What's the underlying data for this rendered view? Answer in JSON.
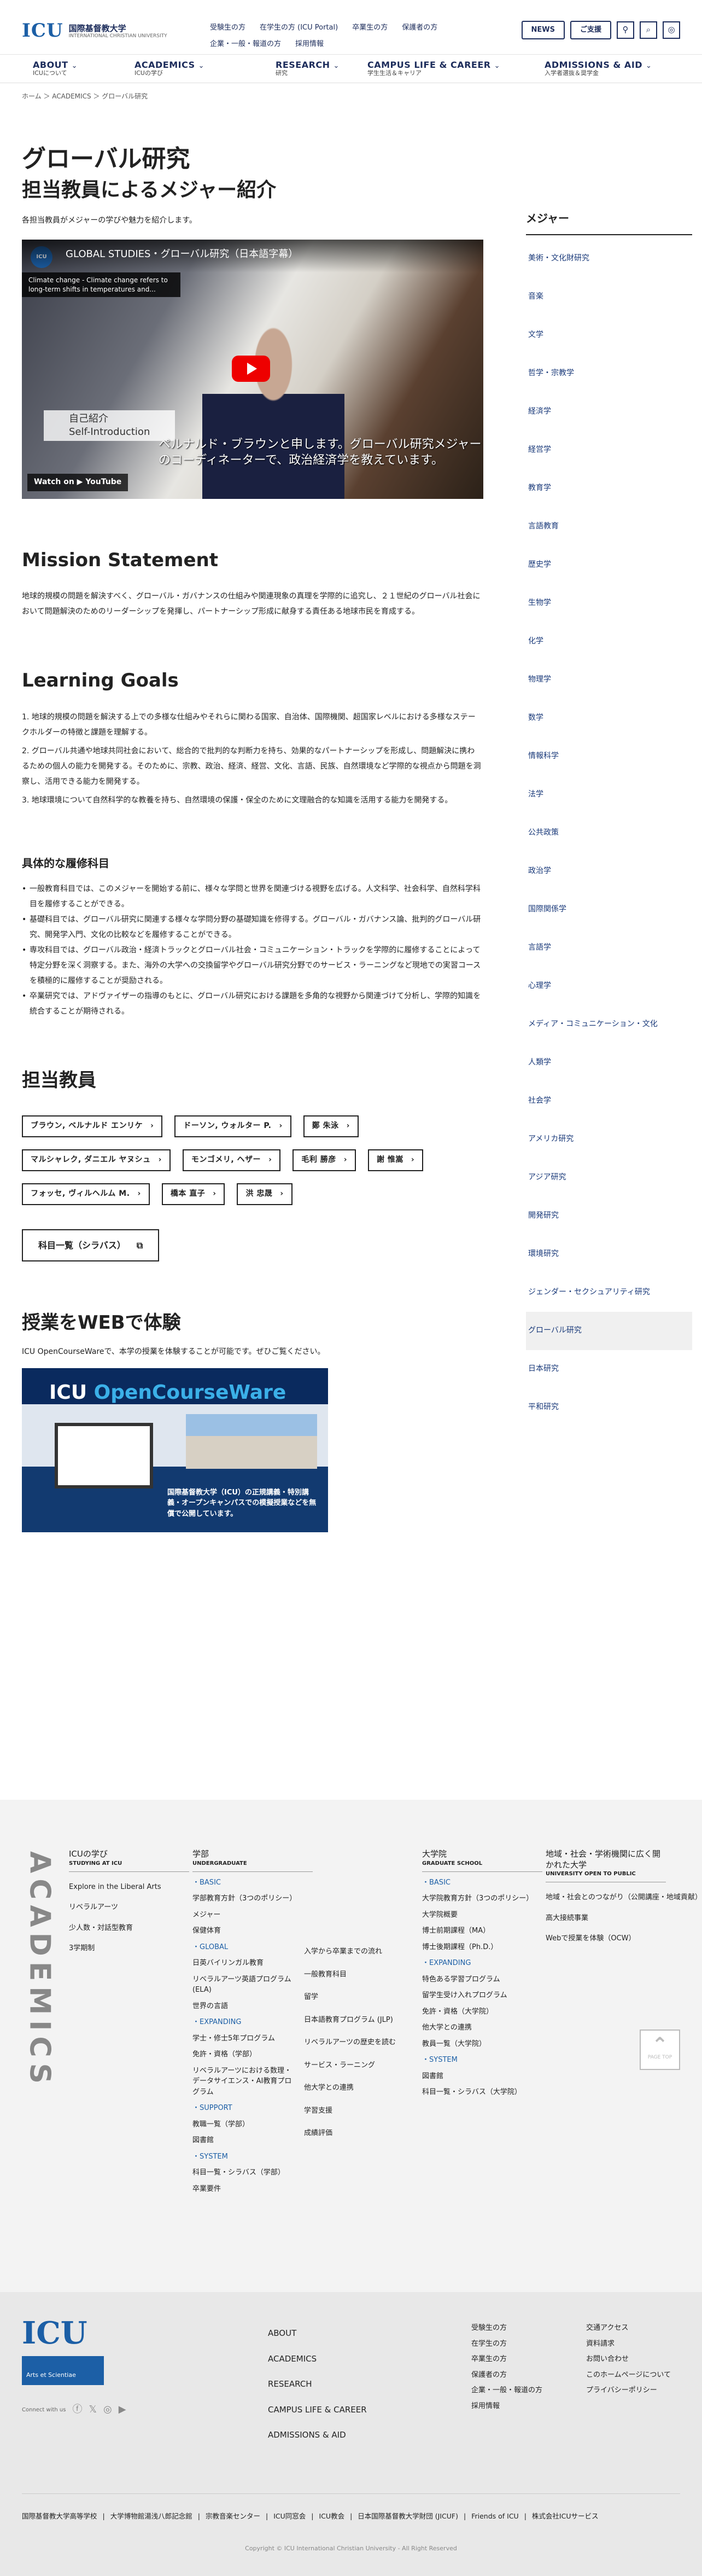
{
  "header": {
    "logo": "ICU",
    "school": "国際基督教大学",
    "school_en": "INTERNATIONAL CHRISTIAN UNIVERSITY",
    "util": [
      "受験生の方",
      "在学生の方 (ICU Portal)",
      "卒業生の方",
      "保護者の方",
      "企業・一般・報道の方",
      "採用情報"
    ],
    "news": "NEWS",
    "donate": "ご支援",
    "map_icon": "pin-icon",
    "search_icon": "search-icon",
    "lang_icon": "globe-icon"
  },
  "nav": [
    {
      "en": "ABOUT",
      "ja": "ICUについて"
    },
    {
      "en": "ACADEMICS",
      "ja": "ICUの学び"
    },
    {
      "en": "RESEARCH",
      "ja": "研究"
    },
    {
      "en": "CAMPUS LIFE & CAREER",
      "ja": "学生生活＆キャリア"
    },
    {
      "en": "ADMISSIONS & AID",
      "ja": "入学者選抜＆奨学金"
    }
  ],
  "breadcrumb": "ホーム ＞ ACADEMICS ＞ グローバル研究",
  "page": {
    "title": "グローバル研究",
    "subtitle": "担当教員によるメジャー紹介",
    "lead": "各担当教員がメジャーの学びや魅力を紹介します。"
  },
  "video": {
    "title": "GLOBAL STUDIES・グローバル研究（日本語字幕）",
    "caption": "Climate change - Climate change refers to long-term shifts in temperatures and...",
    "label1": "自己紹介",
    "label2": "Self-Introduction",
    "subtitle": "ペルナルド・ブラウンと申します。グローバル研究メジャーのコーディネーターで、政治経済学を教えています。",
    "watch": "Watch on ▶ YouTube"
  },
  "mission": {
    "title": "Mission Statement",
    "text": "地球的規模の問題を解決すべく、グローバル・ガバナンスの仕組みや関連現象の真理を学際的に追究し、２１世紀のグローバル社会において問題解決のためのリーダーシップを発揮し、パートナーシップ形成に献身する責任ある地球市民を育成する。"
  },
  "goals": {
    "title": "Learning Goals",
    "items": [
      "1. 地球的規模の問題を解決する上での多様な仕組みやそれらに関わる国家、自治体、国際機関、超国家レベルにおける多様なステークホルダーの特徴と課題を理解する。",
      "2. グローバル共通や地球共同社会において、総合的で批判的な判断力を持ち、効果的なパートナーシップを形成し、問題解決に携わるための個人の能力を開発する。そのために、宗教、政治、経済、経営、文化、言語、民族、自然環境など学際的な視点から問題を洞察し、活用できる能力を開発する。",
      "3. 地球環境について自然科学的な教養を持ち、自然環境の保護・保全のために文理融合的な知識を活用する能力を開発する。"
    ]
  },
  "courses": {
    "title": "具体的な履修科目",
    "items": [
      "一般教育科目では、このメジャーを開始する前に、様々な学問と世界を関連づける視野を広げる。人文科学、社会科学、自然科学科目を履修することができる。",
      "基礎科目では、グローバル研究に関連する様々な学問分野の基礎知識を修得する。グローバル・ガバナンス論、批判的グローバル研究、開発学入門、文化の比較などを履修することができる。",
      "専攻科目では、グローバル政治・経済トラックとグローバル社会・コミュニケーション・トラックを学際的に履修することによって特定分野を深く洞察する。また、海外の大学への交換留学やグローバル研究分野でのサービス・ラーニングなど現地での実習コースを積極的に履修することが奨励される。",
      "卒業研究では、アドヴァイザーの指導のもとに、グローバル研究における課題を多角的な視野から関連づけて分析し、学際的知識を統合することが期待される。"
    ]
  },
  "faculty": {
    "title": "担当教員",
    "members": [
      "ブラウン, ベルナルド エンリケ",
      "ドーソン, ウォルター P.",
      "鄭 朱泳",
      "マルシャレク, ダニエル ヤヌシュ",
      "モンゴメリ, ヘザー",
      "毛利 勝彦",
      "謝 惟嵩",
      "フォッセ, ヴィルヘルム M.",
      "橋本 直子",
      "洪 忠晟"
    ],
    "syllabus": "科目一覧（シラバス）"
  },
  "web": {
    "title": "授業をWEBで体験",
    "text": "ICU OpenCourseWareで、本学の授業を体験することが可能です。ぜひご覧ください。",
    "banner_a": "ICU ",
    "banner_b": "OpenCourseWare",
    "banner_text": "国際基督教大学（ICU）の正規講義・特別講義・オープンキャンパスでの模擬授業などを無償で公開しています。"
  },
  "side": {
    "title": "メジャー",
    "items": [
      "美術・文化財研究",
      "音楽",
      "文学",
      "哲学・宗教学",
      "経済学",
      "経営学",
      "教育学",
      "言語教育",
      "歴史学",
      "生物学",
      "化学",
      "物理学",
      "数学",
      "情報科学",
      "法学",
      "公共政策",
      "政治学",
      "国際関係学",
      "言語学",
      "心理学",
      "メディア・コミュニケーション・文化",
      "人類学",
      "社会学",
      "アメリカ研究",
      "アジア研究",
      "開発研究",
      "環境研究",
      "ジェンダー・セクシュアリティ研究",
      "グローバル研究",
      "日本研究",
      "平和研究"
    ],
    "active": "グローバル研究"
  },
  "footer": {
    "vertical": "ACADEMICS",
    "c1": {
      "t": "ICUの学び",
      "s": "STUDYING AT ICU",
      "items": [
        "Explore in the Liberal Arts",
        "リベラルアーツ",
        "少人数・対話型教育",
        "3学期制"
      ]
    },
    "c2": {
      "t": "学部",
      "s": "UNDERGRADUATE",
      "items": [
        [
          "・BASIC",
          "cat"
        ],
        [
          "学部教育方針（3つのポリシー）",
          ""
        ],
        [
          "メジャー",
          ""
        ],
        [
          "保健体育",
          ""
        ],
        [
          "・GLOBAL",
          "cat"
        ],
        [
          "日英バイリンガル教育",
          ""
        ],
        [
          "リベラルアーツ英語プログラム (ELA)",
          ""
        ],
        [
          "世界の言語",
          ""
        ],
        [
          "・EXPANDING",
          "cat"
        ],
        [
          "学士・修士5年プログラム",
          ""
        ],
        [
          "免許・資格（学部）",
          ""
        ],
        [
          "リベラルアーツにおける数理・データサイエンス・AI教育プログラム",
          ""
        ],
        [
          "・SUPPORT",
          "cat"
        ],
        [
          "教職一覧（学部）",
          ""
        ],
        [
          "図書館",
          ""
        ],
        [
          "・SYSTEM",
          "cat"
        ],
        [
          "科目一覧・シラバス（学部）",
          ""
        ],
        [
          "卒業要件",
          ""
        ]
      ]
    },
    "c2b": [
      "入学から卒業までの流れ",
      "一般教育科目",
      "留学",
      "日本語教育プログラム (JLP)",
      "リベラルアーツの歴史を読む",
      "サービス・ラーニング",
      "他大学との連携",
      "学習支援",
      "成績評価"
    ],
    "c3": {
      "t": "大学院",
      "s": "GRADUATE SCHOOL",
      "items": [
        [
          "・BASIC",
          "cat"
        ],
        [
          "大学院教育方針（3つのポリシー）",
          ""
        ],
        [
          "大学院概要",
          ""
        ],
        [
          "博士前期課程（MA）",
          ""
        ],
        [
          "博士後期課程（Ph.D.）",
          ""
        ],
        [
          "・EXPANDING",
          "cat"
        ],
        [
          "特色ある学習プログラム",
          ""
        ],
        [
          "留学生受け入れプログラム",
          ""
        ],
        [
          "免許・資格（大学院）",
          ""
        ],
        [
          "他大学との連携",
          ""
        ],
        [
          "教員一覧（大学院）",
          ""
        ],
        [
          "・SYSTEM",
          "cat"
        ],
        [
          "図書館",
          ""
        ],
        [
          "科目一覧・シラバス（大学院）",
          ""
        ]
      ]
    },
    "c4": {
      "t": "地域・社会・学術機関に広く開かれた大学",
      "s": "UNIVERSITY OPEN TO PUBLIC",
      "items": [
        "地域・社会とのつながり（公開講座・地域貢献）",
        "高大接続事業",
        "Webで授業を体験（OCW）"
      ]
    },
    "pagetop": "PAGE TOP",
    "logo": "ICU",
    "logo_sub": "Arts et Scientiae",
    "connect": "Connect with us",
    "nav1": [
      "ABOUT",
      "ACADEMICS",
      "RESEARCH",
      "CAMPUS LIFE & CAREER",
      "ADMISSIONS & AID"
    ],
    "nav2": [
      "受験生の方",
      "在学生の方",
      "卒業生の方",
      "保護者の方",
      "企業・一般・報道の方",
      "採用情報"
    ],
    "nav3": [
      "交通アクセス",
      "資料請求",
      "お問い合わせ",
      "このホームページについて",
      "プライバシーポリシー"
    ],
    "links": [
      "国際基督教大学高等学校",
      "大学博物館湯浅八郎記念館",
      "宗教音楽センター",
      "ICU同窓会",
      "ICU教会",
      "日本国際基督教大学財団 (JICUF)",
      "Friends of ICU",
      "株式会社ICUサービス"
    ],
    "copy": "Copyright © ICU International Christian University - All Right Reserved"
  }
}
